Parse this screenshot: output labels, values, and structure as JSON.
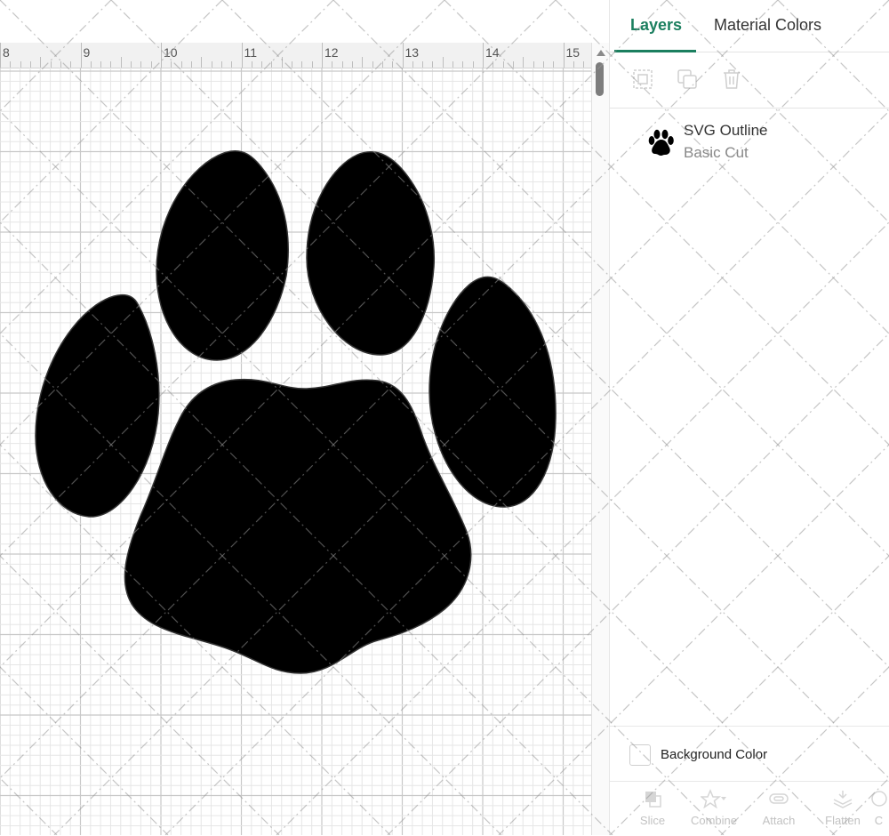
{
  "ruler": {
    "labels": [
      "8",
      "9",
      "10",
      "11",
      "12",
      "13",
      "14",
      "15"
    ]
  },
  "design": {
    "shape": "paw-print",
    "fill_color": "#000000"
  },
  "panel": {
    "tabs": [
      {
        "label": "Layers",
        "active": true
      },
      {
        "label": "Material Colors",
        "active": false
      }
    ],
    "toolbar_icons": [
      "group-icon",
      "duplicate-icon",
      "delete-icon"
    ],
    "layer": {
      "name": "SVG Outline",
      "operation": "Basic Cut",
      "thumbnail_icon": "paw-print-icon"
    },
    "background_color_label": "Background Color",
    "bottom_tools": [
      {
        "label": "Slice",
        "icon": "slice-icon"
      },
      {
        "label": "Combine",
        "icon": "combine-icon"
      },
      {
        "label": "Attach",
        "icon": "attach-icon"
      },
      {
        "label": "Flatten",
        "icon": "flatten-icon"
      },
      {
        "label": "C",
        "icon": "contour-icon"
      }
    ]
  },
  "colors": {
    "accent": "#1b7f5f",
    "disabled": "#c2c2c2"
  }
}
